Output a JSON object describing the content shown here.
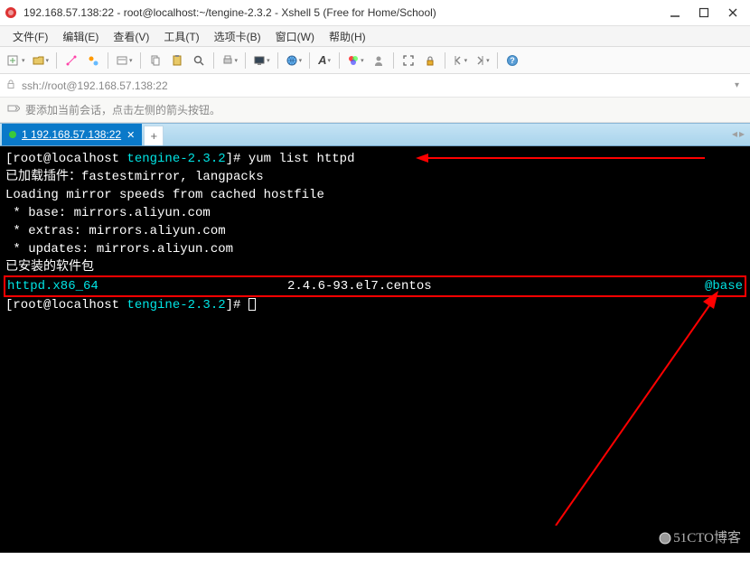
{
  "titlebar": {
    "title": "192.168.57.138:22 - root@localhost:~/tengine-2.3.2 - Xshell 5 (Free for Home/School)"
  },
  "menubar": {
    "file": "文件(F)",
    "edit": "编辑(E)",
    "view": "查看(V)",
    "tools": "工具(T)",
    "tabs": "选项卡(B)",
    "window": "窗口(W)",
    "help": "帮助(H)"
  },
  "addressbar": {
    "url": "ssh://root@192.168.57.138:22"
  },
  "infobar": {
    "text": "要添加当前会话，点击左侧的箭头按钮。"
  },
  "tabs": {
    "active_label": "1 192.168.57.138:22"
  },
  "terminal": {
    "prompt1_user": "[root@localhost ",
    "prompt1_path": "tengine-2.3.2",
    "prompt1_close": "]# ",
    "cmd1": "yum list httpd",
    "line2": "已加载插件：fastestmirror, langpacks",
    "line3": "Loading mirror speeds from cached hostfile",
    "line4": " * base: mirrors.aliyun.com",
    "line5": " * extras: mirrors.aliyun.com",
    "line6": " * updates: mirrors.aliyun.com",
    "line7": "已安装的软件包",
    "hl_pkg": "httpd.x86_64",
    "hl_ver": "2.4.6-93.el7.centos",
    "hl_repo": "@base",
    "prompt2_user": "[root@localhost ",
    "prompt2_path": "tengine-2.3.2",
    "prompt2_close": "]# "
  },
  "watermark": "51CTO博客",
  "colors": {
    "arrow": "#ff0000",
    "cyan": "#00e4e4",
    "tab_active_bg": "#0a79c9"
  }
}
